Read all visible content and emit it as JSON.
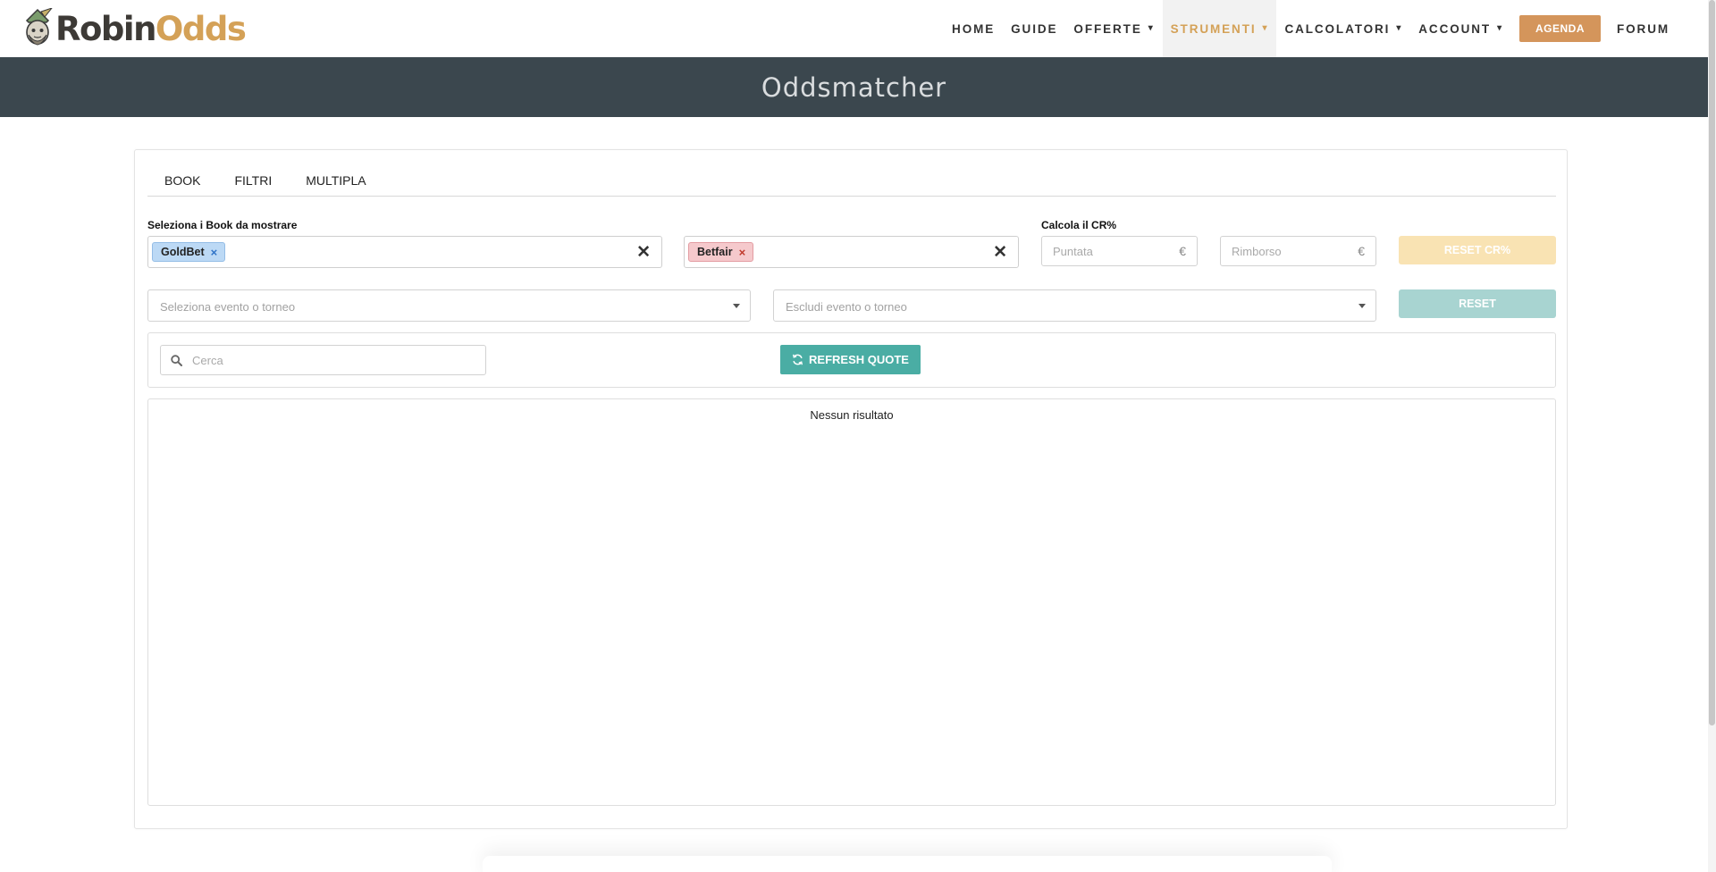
{
  "brand": {
    "name_part1": "Robin",
    "name_part2": "Odds",
    "primary_color": "#d4a157",
    "dark_color": "#3b474e",
    "teal_color": "#4aada4"
  },
  "nav": {
    "items": [
      {
        "label": "HOME",
        "has_dropdown": false
      },
      {
        "label": "GUIDE",
        "has_dropdown": false
      },
      {
        "label": "OFFERTE",
        "has_dropdown": true
      },
      {
        "label": "STRUMENTI",
        "has_dropdown": true,
        "active": true
      },
      {
        "label": "CALCOLATORI",
        "has_dropdown": true
      },
      {
        "label": "ACCOUNT",
        "has_dropdown": true
      }
    ],
    "cta_label": "AGENDA",
    "forum_label": "FORUM",
    "chevron": "▾"
  },
  "page": {
    "title": "Oddsmatcher"
  },
  "tabs": [
    "BOOK",
    "FILTRI",
    "MULTIPLA"
  ],
  "book_select": {
    "label": "Seleziona i Book da mostrare",
    "bookmaker_tag": "GoldBet",
    "exchange_tag": "Betfair",
    "remove_glyph": "×",
    "clear_glyph": "✕"
  },
  "cr_calc": {
    "label": "Calcola il CR%",
    "stake_placeholder": "Puntata",
    "refund_placeholder": "Rimborso",
    "currency": "€",
    "reset_cr_label": "RESET CR%"
  },
  "event_filters": {
    "include_placeholder": "Seleziona evento o torneo",
    "exclude_placeholder": "Escludi evento o torneo",
    "reset_label": "RESET"
  },
  "toolbar": {
    "search_placeholder": "Cerca",
    "refresh_label": "REFRESH QUOTE"
  },
  "results": {
    "empty_message": "Nessun risultato"
  }
}
